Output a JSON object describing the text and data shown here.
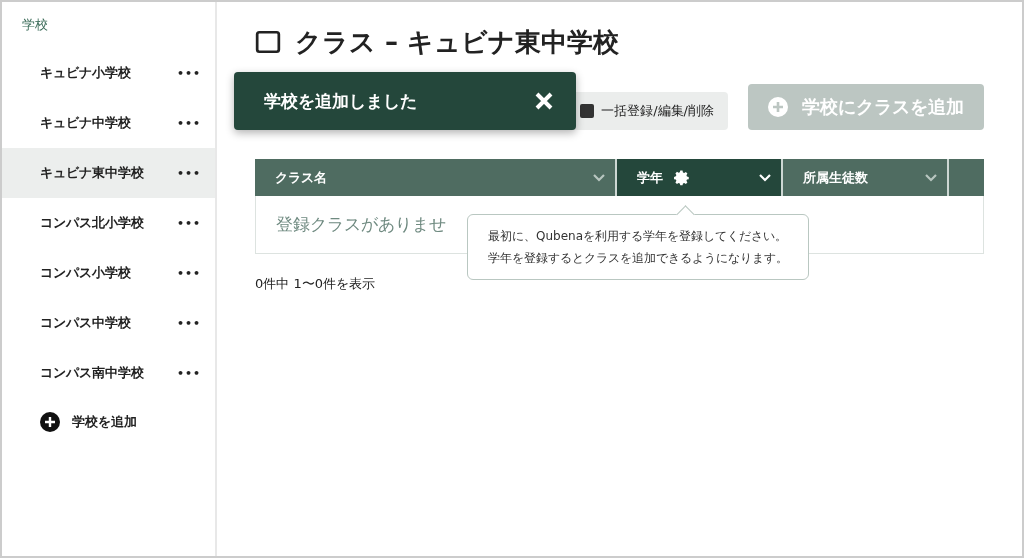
{
  "sidebar": {
    "heading": "学校",
    "items": [
      {
        "label": "キュビナ小学校",
        "selected": false,
        "menu": "•••"
      },
      {
        "label": "キュビナ中学校",
        "selected": false,
        "menu": "•••"
      },
      {
        "label": "キュビナ東中学校",
        "selected": true,
        "menu": "•••"
      },
      {
        "label": "コンパス北小学校",
        "selected": false,
        "menu": "•••"
      },
      {
        "label": "コンパス小学校",
        "selected": false,
        "menu": "•••"
      },
      {
        "label": "コンパス中学校",
        "selected": false,
        "menu": "•••"
      },
      {
        "label": "コンパス南中学校",
        "selected": false,
        "menu": "•••"
      }
    ],
    "add_label": "学校を追加"
  },
  "main": {
    "title": "クラス – キュビナ東中学校",
    "bulk_button": "一括登録/編集/削除",
    "add_button": {
      "label": "学校にクラスを追加",
      "disabled": true
    }
  },
  "table": {
    "columns": [
      {
        "label": "クラス名",
        "selected": false,
        "settings": false
      },
      {
        "label": "学年",
        "selected": true,
        "settings": true
      },
      {
        "label": "所属生徒数",
        "selected": false,
        "settings": false
      }
    ],
    "empty": "登録クラスがありませ"
  },
  "tooltip": [
    "最初に、Qubenaを利用する学年を登録してください。",
    "学年を登録するとクラスを追加できるようになります。"
  ],
  "pagination": "0件中 1〜0件を表示",
  "toast": {
    "message": "学校を追加しました"
  }
}
